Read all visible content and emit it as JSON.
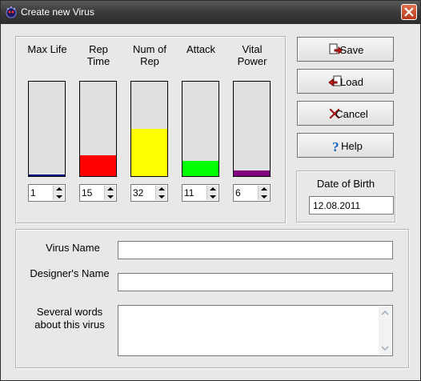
{
  "window": {
    "title": "Create new Virus"
  },
  "stats": [
    {
      "key": "max-life",
      "label_lines": [
        "Max Life"
      ],
      "value": "1",
      "level": 0.02,
      "color": "#000080"
    },
    {
      "key": "rep-time",
      "label_lines": [
        "Rep",
        "Time"
      ],
      "value": "15",
      "level": 0.22,
      "color": "#ff0000"
    },
    {
      "key": "num-of-rep",
      "label_lines": [
        "Num of",
        "Rep"
      ],
      "value": "32",
      "level": 0.5,
      "color": "#ffff00"
    },
    {
      "key": "attack",
      "label_lines": [
        "Attack"
      ],
      "value": "11",
      "level": 0.16,
      "color": "#00ff00"
    },
    {
      "key": "vital-power",
      "label_lines": [
        "Vital",
        "Power"
      ],
      "value": "6",
      "level": 0.06,
      "color": "#800080"
    }
  ],
  "buttons": {
    "save": "Save",
    "load": "Load",
    "cancel": "Cancel",
    "help": "Help"
  },
  "birth": {
    "label": "Date of Birth",
    "value": "12.08.2011"
  },
  "form": {
    "virus_name_label": "Virus Name",
    "designer_label": "Designer's Name",
    "about_label_line1": "Several words",
    "about_label_line2": "about this virus",
    "virus_name_value": "",
    "designer_value": "",
    "about_value": ""
  }
}
